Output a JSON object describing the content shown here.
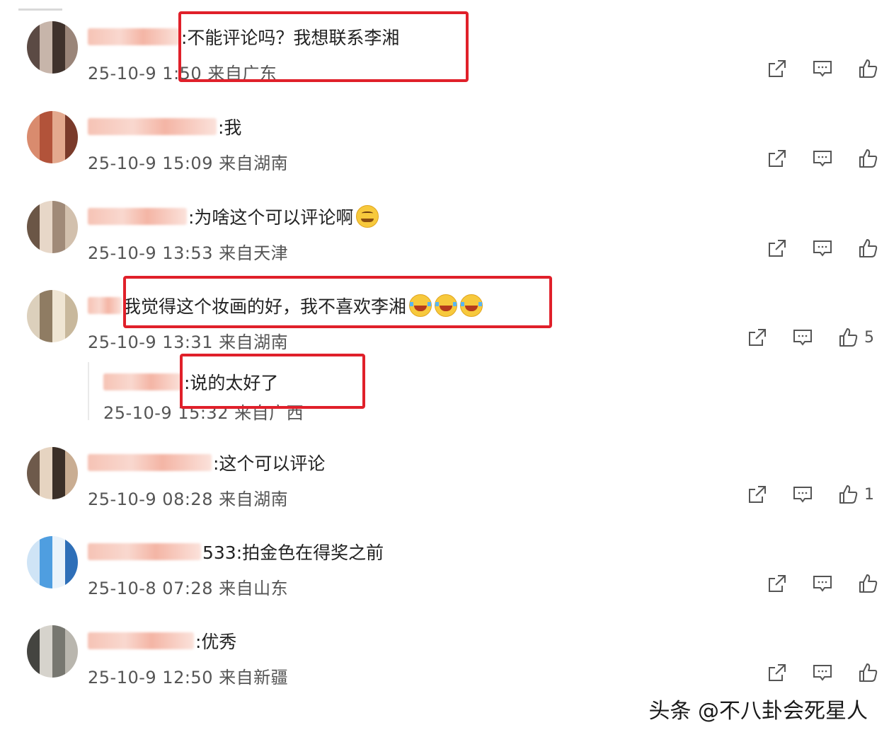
{
  "comments": [
    {
      "text": ":不能评论吗？我想联系李湘",
      "time": "25-10-9 1",
      "time_hidden": ":50 来自广东",
      "avatar": [
        "#5b4a44",
        "#9a8579",
        "#3f322c",
        "#c7b5aa"
      ],
      "likes": ""
    },
    {
      "text": ":我",
      "time": "25-10-9 15:09 来自湖南",
      "avatar": [
        "#b2533a",
        "#d98b6e",
        "#7a3a2a",
        "#e3a98e"
      ],
      "likes": ""
    },
    {
      "text": ":为啥这个可以评论啊",
      "time": "25-10-9 13:53 来自天津",
      "avatar": [
        "#a08a78",
        "#e7d7c8",
        "#6b5646",
        "#d2c0ad"
      ],
      "likes": ""
    },
    {
      "text": "我觉得这个妆画的好，我不喜欢李湘",
      "time": "25-10-9 13:31 来自湖南",
      "avatar": [
        "#c8b89c",
        "#efe5d3",
        "#8f7c63",
        "#dcd0bc"
      ],
      "likes": "5"
    },
    {
      "text": ":这个可以评论",
      "time": "25-10-9 08:28 来自湖南",
      "avatar": [
        "#6e5a4b",
        "#c9ad92",
        "#3b2f27",
        "#e6d4c1"
      ],
      "likes": "1"
    },
    {
      "text": "533:拍金色在得奖之前",
      "time": "25-10-8 07:28 来自山东",
      "avatar": [
        "#4f9ee0",
        "#cfe4f6",
        "#2e6fb8",
        "#eaf3fb"
      ],
      "likes": ""
    },
    {
      "text": ":优秀",
      "time": "25-10-9 12:50 来自新疆",
      "avatar": [
        "#777770",
        "#d6d3cc",
        "#444440",
        "#b9b6ae"
      ],
      "likes": ""
    }
  ],
  "reply": {
    "text": ":说的太好了",
    "time": "25-10-9 15:32 来自广西"
  },
  "watermark": "头条 @不八卦会死星人",
  "icons": {
    "share": "share-icon",
    "comment": "comment-icon",
    "like": "thumbs-up-icon"
  },
  "colors": {
    "highlight": "#e0202a",
    "meta": "#555555"
  }
}
